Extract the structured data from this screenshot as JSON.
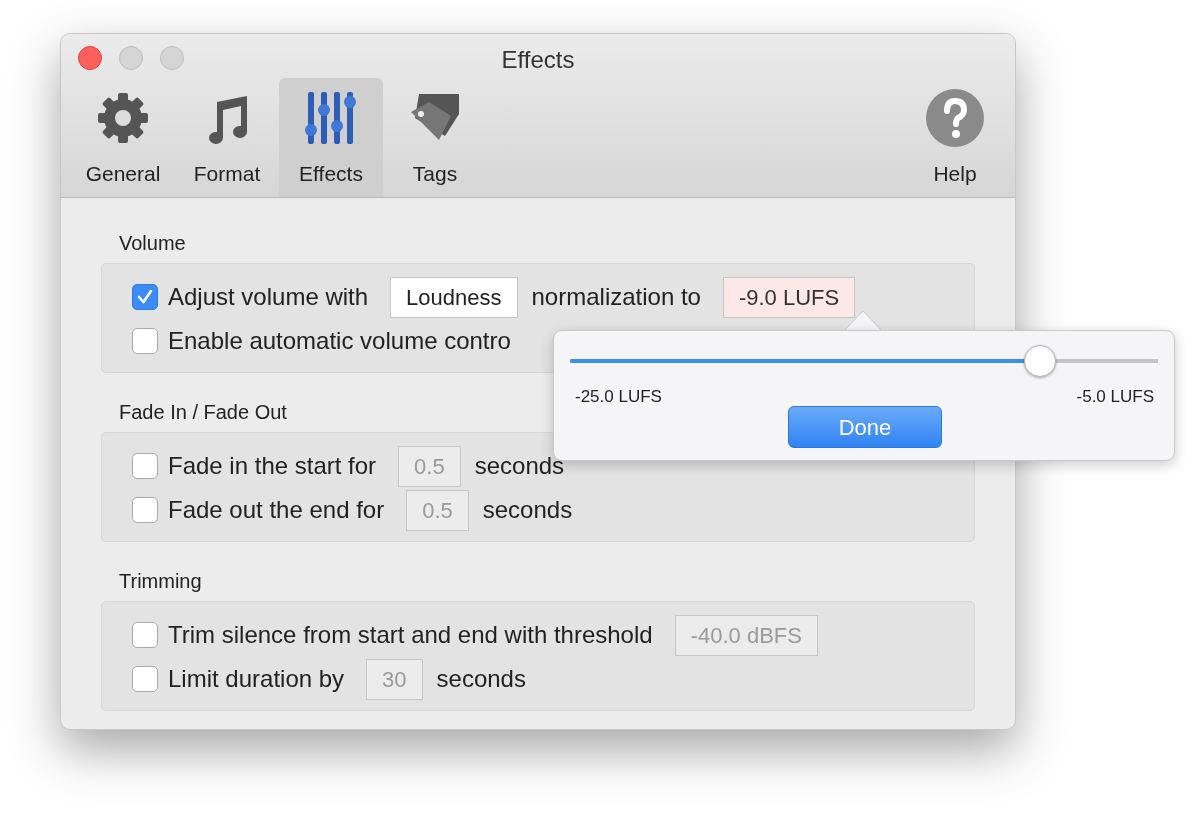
{
  "window": {
    "title": "Effects"
  },
  "toolbar": [
    {
      "kind": "gear",
      "label": "General",
      "selected": false
    },
    {
      "kind": "note",
      "label": "Format",
      "selected": false
    },
    {
      "kind": "sliders",
      "label": "Effects",
      "selected": true
    },
    {
      "kind": "tag",
      "label": "Tags",
      "selected": false
    },
    {
      "kind": "help",
      "label": "Help",
      "selected": false
    }
  ],
  "sections": [
    {
      "title": "Volume",
      "rows": [
        {
          "checked": true,
          "parts": [
            {
              "kind": "text",
              "text": "Adjust volume with"
            },
            {
              "kind": "field",
              "value": "Loudness",
              "disabled": false,
              "highlighted": false
            },
            {
              "kind": "text",
              "text": "normalization to"
            },
            {
              "kind": "field",
              "value": "-9.0 LUFS",
              "disabled": false,
              "highlighted": true
            }
          ]
        },
        {
          "checked": false,
          "parts": [
            {
              "kind": "text",
              "text": "Enable automatic volume contro"
            }
          ]
        }
      ]
    },
    {
      "title": "Fade In / Fade Out",
      "rows": [
        {
          "checked": false,
          "parts": [
            {
              "kind": "text",
              "text": "Fade in the start for"
            },
            {
              "kind": "field",
              "value": "0.5",
              "disabled": true,
              "highlighted": false
            },
            {
              "kind": "text",
              "text": "seconds"
            }
          ]
        },
        {
          "checked": false,
          "parts": [
            {
              "kind": "text",
              "text": "Fade out the end for"
            },
            {
              "kind": "field",
              "value": "0.5",
              "disabled": true,
              "highlighted": false
            },
            {
              "kind": "text",
              "text": "seconds"
            }
          ]
        }
      ]
    },
    {
      "title": "Trimming",
      "rows": [
        {
          "checked": false,
          "parts": [
            {
              "kind": "text",
              "text": "Trim silence from start and end with threshold"
            },
            {
              "kind": "field",
              "value": "-40.0 dBFS",
              "disabled": true,
              "highlighted": false
            }
          ]
        },
        {
          "checked": false,
          "parts": [
            {
              "kind": "text",
              "text": "Limit duration by"
            },
            {
              "kind": "field",
              "value": "30",
              "disabled": true,
              "highlighted": false
            },
            {
              "kind": "text",
              "text": "seconds"
            }
          ]
        }
      ]
    }
  ],
  "popover": {
    "slider": {
      "level": 0.8
    },
    "min_label": "-25.0 LUFS",
    "max_label": "-5.0 LUFS",
    "button": "Done"
  }
}
